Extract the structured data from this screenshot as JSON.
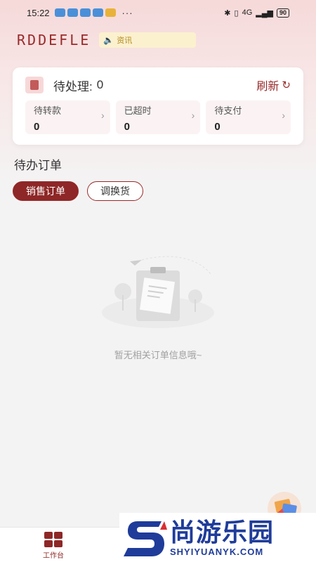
{
  "status_bar": {
    "time": "15:22",
    "more": "···",
    "network": "4G",
    "battery": "90"
  },
  "header": {
    "logo": "RDDEFLE",
    "news": "资讯"
  },
  "pending_card": {
    "label": "待处理:",
    "value": "0",
    "refresh": "刷新",
    "stats": [
      {
        "label": "待转款",
        "value": "0"
      },
      {
        "label": "已超时",
        "value": "0"
      },
      {
        "label": "待支付",
        "value": "0"
      }
    ]
  },
  "orders": {
    "title": "待办订单",
    "tabs": [
      {
        "label": "销售订单",
        "active": true
      },
      {
        "label": "调换货",
        "active": false
      }
    ],
    "empty_text": "暂无相关订单信息哦~"
  },
  "bottom_nav": {
    "workbench": "工作台"
  },
  "watermark": {
    "cn": "尚游乐园",
    "en": "SHYIYUANYK.COM"
  },
  "colors": {
    "accent": "#8e2727",
    "background": "#f4f3f3",
    "news_bg": "#fbf1cf"
  }
}
